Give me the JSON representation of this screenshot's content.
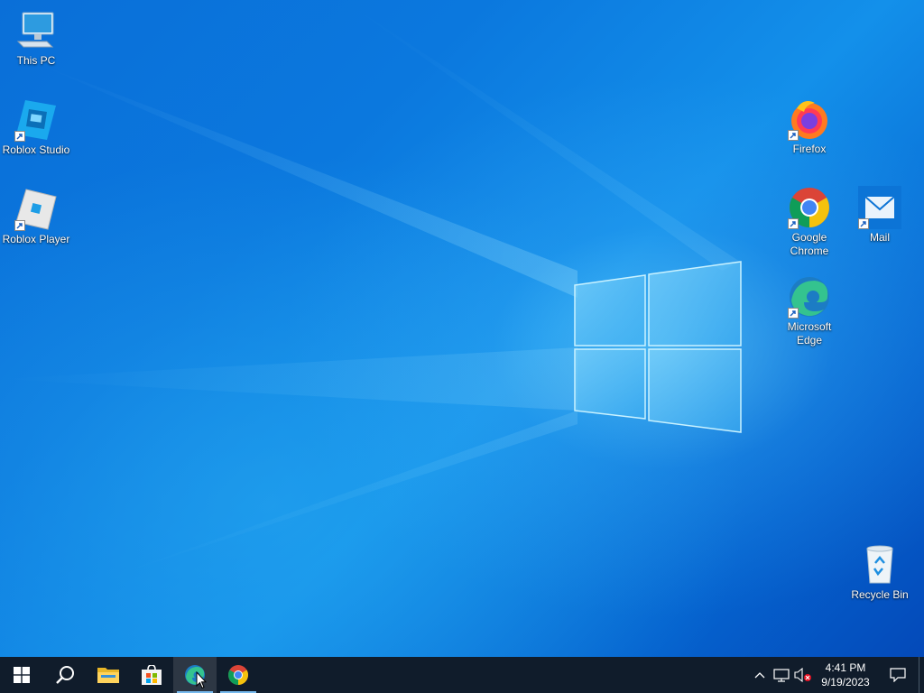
{
  "desktop": {
    "icons_left": [
      {
        "label": "This PC",
        "icon": "this-pc-icon"
      },
      {
        "label": "Roblox Studio",
        "icon": "roblox-studio-icon"
      },
      {
        "label": "Roblox Player",
        "icon": "roblox-player-icon"
      }
    ],
    "icons_right": [
      {
        "label": "Firefox",
        "icon": "firefox-icon"
      },
      {
        "label": "Google Chrome",
        "icon": "chrome-icon"
      },
      {
        "label": "Mail",
        "icon": "mail-icon"
      },
      {
        "label": "Microsoft Edge",
        "icon": "edge-icon"
      },
      {
        "label": "Recycle Bin",
        "icon": "recycle-bin-icon"
      }
    ]
  },
  "taskbar": {
    "items": [
      "start-button",
      "search-button",
      "file-explorer",
      "microsoft-store",
      "microsoft-edge",
      "google-chrome"
    ],
    "clock": {
      "time": "4:41 PM",
      "date": "9/19/2023"
    }
  },
  "colors": {
    "taskbar_bg": "#101c2b",
    "wallpaper_accent": "#0a6fd8",
    "running_indicator": "#76b9ed"
  }
}
